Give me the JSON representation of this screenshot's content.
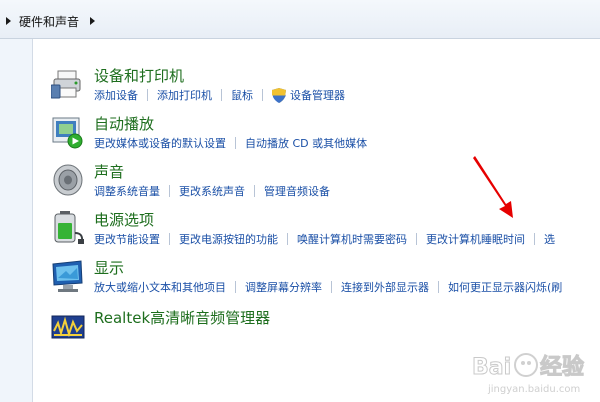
{
  "breadcrumb": {
    "label": "硬件和声音"
  },
  "categories": [
    {
      "title": "设备和打印机",
      "links": [
        "添加设备",
        "添加打印机",
        "鼠标",
        "设备管理器"
      ]
    },
    {
      "title": "自动播放",
      "links": [
        "更改媒体或设备的默认设置",
        "自动播放 CD 或其他媒体"
      ]
    },
    {
      "title": "声音",
      "links": [
        "调整系统音量",
        "更改系统声音",
        "管理音频设备"
      ]
    },
    {
      "title": "电源选项",
      "links": [
        "更改节能设置",
        "更改电源按钮的功能",
        "唤醒计算机时需要密码",
        "更改计算机睡眠时间",
        "选"
      ]
    },
    {
      "title": "显示",
      "links": [
        "放大或缩小文本和其他项目",
        "调整屏幕分辨率",
        "连接到外部显示器",
        "如何更正显示器闪烁(刷"
      ]
    },
    {
      "title": "Realtek高清晰音频管理器",
      "links": []
    }
  ],
  "colors": {
    "title_green": "#1e6e1e",
    "link_blue": "#1a4fa6",
    "annotation_red": "#e60000"
  },
  "watermark": {
    "text": "Bai经验",
    "sub": "jingyan.baidu.com"
  }
}
